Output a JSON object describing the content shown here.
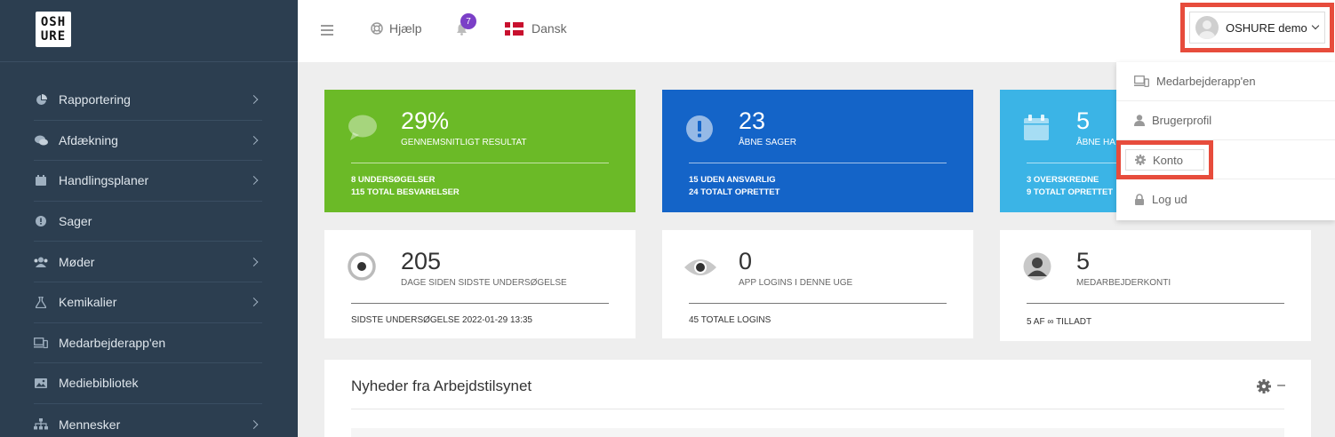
{
  "logo": {
    "line1": "OSH",
    "line2": "URE"
  },
  "sidebar": {
    "items": [
      {
        "label": "Rapportering",
        "icon": "pie-chart-icon",
        "has_children": true
      },
      {
        "label": "Afdækning",
        "icon": "comments-icon",
        "has_children": true
      },
      {
        "label": "Handlingsplaner",
        "icon": "calendar-icon",
        "has_children": true
      },
      {
        "label": "Sager",
        "icon": "exclamation-icon",
        "has_children": false
      },
      {
        "label": "Møder",
        "icon": "users-icon",
        "has_children": true
      },
      {
        "label": "Kemikalier",
        "icon": "flask-icon",
        "has_children": true
      },
      {
        "label": "Medarbejderapp'en",
        "icon": "devices-icon",
        "has_children": false
      },
      {
        "label": "Mediebibliotek",
        "icon": "image-icon",
        "has_children": false
      },
      {
        "label": "Mennesker",
        "icon": "sitemap-icon",
        "has_children": true
      }
    ]
  },
  "topbar": {
    "help_label": "Hjælp",
    "notification_count": "7",
    "language_label": "Dansk",
    "user_name": "OSHURE demo"
  },
  "user_menu": {
    "items": [
      {
        "label": "Medarbejderapp'en",
        "icon": "devices-icon"
      },
      {
        "label": "Brugerprofil",
        "icon": "user-icon"
      },
      {
        "label": "Konto",
        "icon": "gear-icon"
      },
      {
        "label": "Log ud",
        "icon": "lock-icon"
      }
    ]
  },
  "stats": [
    {
      "value": "29%",
      "label": "GENNEMSNITLIGT RESULTAT",
      "foot1": "8 UNDERSØGELSER",
      "foot2": "115 TOTAL BESVARELSER",
      "color": "#6bba27",
      "icon": "speech-bubble-icon"
    },
    {
      "value": "23",
      "label": "ÅBNE SAGER",
      "foot1": "15 UDEN ANSVARLIG",
      "foot2": "24 TOTALT OPRETTET",
      "color": "#1464c8",
      "icon": "exclamation-circle-icon"
    },
    {
      "value": "5",
      "label": "ÅBNE HA",
      "foot1": "3 OVERSKREDNE",
      "foot2": "9 TOTALT OPRETTET",
      "color": "#3bb4e6",
      "icon": "calendar-icon"
    },
    {
      "value": "205",
      "label": "DAGE SIDEN SIDSTE UNDERSØGELSE",
      "foot1": "SIDSTE UNDERSØGELSE 2022-01-29 13:35",
      "icon": "target-icon"
    },
    {
      "value": "0",
      "label": "APP LOGINS I DENNE UGE",
      "foot1": "45 TOTALE LOGINS",
      "icon": "eye-icon"
    },
    {
      "value": "5",
      "label": "MEDARBEJDERKONTI",
      "foot1": "5 AF ∞ TILLADT",
      "icon": "user-circle-icon"
    }
  ],
  "news_panel": {
    "title": "Nyheder fra Arbejdstilsynet",
    "collapse_label": "–"
  },
  "colors": {
    "sidebar": "#2c3e50",
    "highlight": "#e74c3c",
    "badge": "#7b3fc7"
  }
}
